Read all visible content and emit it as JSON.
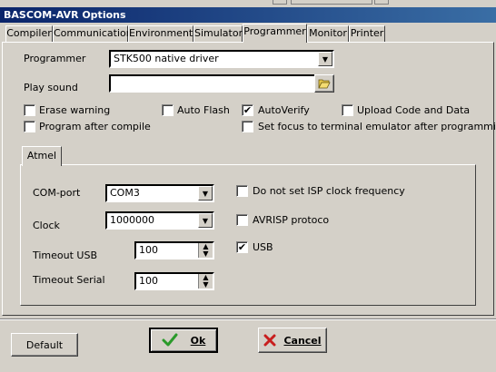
{
  "window": {
    "title": "BASCOM-AVR Options"
  },
  "tabs": [
    {
      "label": "Compiler"
    },
    {
      "label": "Communication"
    },
    {
      "label": "Environment"
    },
    {
      "label": "Simulator"
    },
    {
      "label": "Programmer"
    },
    {
      "label": "Monitor"
    },
    {
      "label": "Printer"
    }
  ],
  "active_tab": "Programmer",
  "programmer": {
    "label": "Programmer",
    "value": "STK500 native driver",
    "play_sound_label": "Play sound",
    "play_sound_value": ""
  },
  "options": {
    "erase_warning": {
      "label": "Erase warning",
      "checked": false
    },
    "auto_flash": {
      "label": "Auto Flash",
      "checked": false
    },
    "auto_verify": {
      "label": "AutoVerify",
      "checked": true
    },
    "upload_code_data": {
      "label": "Upload Code and Data",
      "checked": false
    },
    "program_after_compile": {
      "label": "Program after compile",
      "checked": false
    },
    "set_focus_terminal": {
      "label": "Set focus to terminal emulator after programming",
      "checked": false
    }
  },
  "atmel": {
    "tab_label": "Atmel",
    "com_port_label": "COM-port",
    "com_port_value": "COM3",
    "clock_label": "Clock",
    "clock_value": "1000000",
    "timeout_usb_label": "Timeout USB",
    "timeout_usb_value": "100",
    "timeout_serial_label": "Timeout Serial",
    "timeout_serial_value": "100",
    "no_isp_clock": {
      "label": "Do not set ISP clock frequency",
      "checked": false
    },
    "avrisp_protocol": {
      "label": "AVRISP protoco",
      "checked": false
    },
    "usb": {
      "label": "USB",
      "checked": true
    }
  },
  "buttons": {
    "default_label": "Default",
    "ok_label": "Ok",
    "cancel_label": "Cancel"
  },
  "colors": {
    "titlebar_start": "#0a246a",
    "titlebar_end": "#3a6ea5",
    "face": "#d4d0c8",
    "ok_green": "#2a9a2a",
    "cancel_red": "#c81e1e"
  }
}
